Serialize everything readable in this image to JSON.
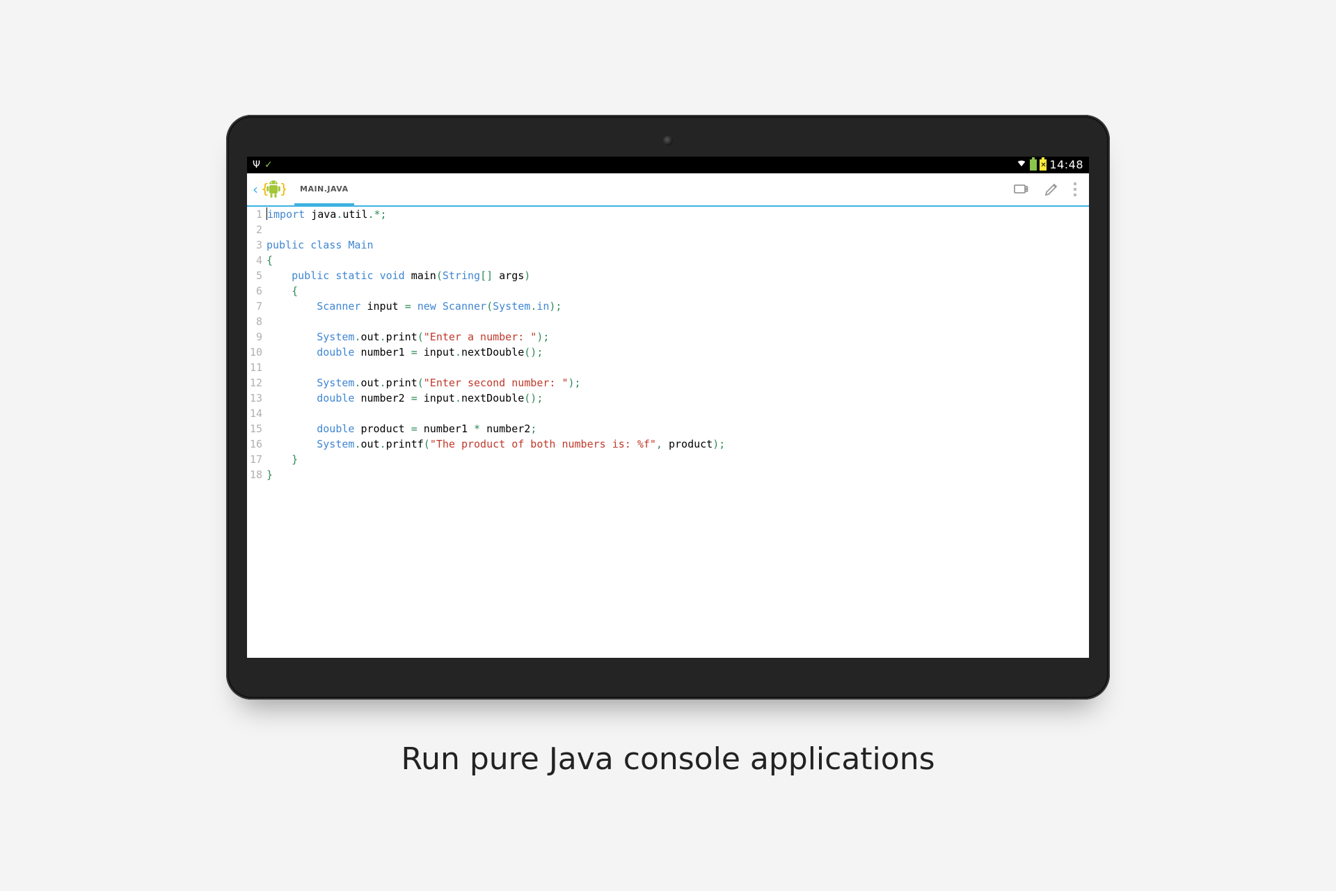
{
  "statusbar": {
    "time": "14:48",
    "icons": {
      "usb": "Ψ",
      "check": "✓"
    }
  },
  "appbar": {
    "tab_label": "MAIN.JAVA"
  },
  "caption": "Run pure Java console applications",
  "code": {
    "lines": [
      {
        "n": "1",
        "spans": [
          {
            "c": "cursor",
            "t": ""
          },
          {
            "c": "kw",
            "t": "import"
          },
          {
            "c": "id",
            "t": " java"
          },
          {
            "c": "pun",
            "t": "."
          },
          {
            "c": "id",
            "t": "util"
          },
          {
            "c": "pun",
            "t": ".*;"
          }
        ]
      },
      {
        "n": "2",
        "spans": []
      },
      {
        "n": "3",
        "spans": [
          {
            "c": "kw",
            "t": "public"
          },
          {
            "c": "id",
            "t": " "
          },
          {
            "c": "kw",
            "t": "class"
          },
          {
            "c": "id",
            "t": " "
          },
          {
            "c": "typ",
            "t": "Main"
          }
        ]
      },
      {
        "n": "4",
        "spans": [
          {
            "c": "pun",
            "t": "{"
          }
        ]
      },
      {
        "n": "5",
        "spans": [
          {
            "c": "id",
            "t": "    "
          },
          {
            "c": "kw",
            "t": "public"
          },
          {
            "c": "id",
            "t": " "
          },
          {
            "c": "kw",
            "t": "static"
          },
          {
            "c": "id",
            "t": " "
          },
          {
            "c": "kw",
            "t": "void"
          },
          {
            "c": "id",
            "t": " main"
          },
          {
            "c": "pun",
            "t": "("
          },
          {
            "c": "typ",
            "t": "String"
          },
          {
            "c": "pun",
            "t": "[]"
          },
          {
            "c": "id",
            "t": " args"
          },
          {
            "c": "pun",
            "t": ")"
          }
        ]
      },
      {
        "n": "6",
        "spans": [
          {
            "c": "id",
            "t": "    "
          },
          {
            "c": "pun",
            "t": "{"
          }
        ]
      },
      {
        "n": "7",
        "spans": [
          {
            "c": "id",
            "t": "        "
          },
          {
            "c": "typ",
            "t": "Scanner"
          },
          {
            "c": "id",
            "t": " input "
          },
          {
            "c": "pun",
            "t": "="
          },
          {
            "c": "id",
            "t": " "
          },
          {
            "c": "kw",
            "t": "new"
          },
          {
            "c": "id",
            "t": " "
          },
          {
            "c": "typ",
            "t": "Scanner"
          },
          {
            "c": "pun",
            "t": "("
          },
          {
            "c": "typ",
            "t": "System"
          },
          {
            "c": "pun",
            "t": "."
          },
          {
            "c": "typ",
            "t": "in"
          },
          {
            "c": "pun",
            "t": ");"
          }
        ]
      },
      {
        "n": "8",
        "spans": []
      },
      {
        "n": "9",
        "spans": [
          {
            "c": "id",
            "t": "        "
          },
          {
            "c": "typ",
            "t": "System"
          },
          {
            "c": "pun",
            "t": "."
          },
          {
            "c": "id",
            "t": "out"
          },
          {
            "c": "pun",
            "t": "."
          },
          {
            "c": "id",
            "t": "print"
          },
          {
            "c": "pun",
            "t": "("
          },
          {
            "c": "str",
            "t": "\"Enter a number: \""
          },
          {
            "c": "pun",
            "t": ");"
          }
        ]
      },
      {
        "n": "10",
        "spans": [
          {
            "c": "id",
            "t": "        "
          },
          {
            "c": "kw",
            "t": "double"
          },
          {
            "c": "id",
            "t": " number1 "
          },
          {
            "c": "pun",
            "t": "="
          },
          {
            "c": "id",
            "t": " input"
          },
          {
            "c": "pun",
            "t": "."
          },
          {
            "c": "id",
            "t": "nextDouble"
          },
          {
            "c": "pun",
            "t": "();"
          }
        ]
      },
      {
        "n": "11",
        "spans": []
      },
      {
        "n": "12",
        "spans": [
          {
            "c": "id",
            "t": "        "
          },
          {
            "c": "typ",
            "t": "System"
          },
          {
            "c": "pun",
            "t": "."
          },
          {
            "c": "id",
            "t": "out"
          },
          {
            "c": "pun",
            "t": "."
          },
          {
            "c": "id",
            "t": "print"
          },
          {
            "c": "pun",
            "t": "("
          },
          {
            "c": "str",
            "t": "\"Enter second number: \""
          },
          {
            "c": "pun",
            "t": ");"
          }
        ]
      },
      {
        "n": "13",
        "spans": [
          {
            "c": "id",
            "t": "        "
          },
          {
            "c": "kw",
            "t": "double"
          },
          {
            "c": "id",
            "t": " number2 "
          },
          {
            "c": "pun",
            "t": "="
          },
          {
            "c": "id",
            "t": " input"
          },
          {
            "c": "pun",
            "t": "."
          },
          {
            "c": "id",
            "t": "nextDouble"
          },
          {
            "c": "pun",
            "t": "();"
          }
        ]
      },
      {
        "n": "14",
        "spans": []
      },
      {
        "n": "15",
        "spans": [
          {
            "c": "id",
            "t": "        "
          },
          {
            "c": "kw",
            "t": "double"
          },
          {
            "c": "id",
            "t": " product "
          },
          {
            "c": "pun",
            "t": "="
          },
          {
            "c": "id",
            "t": " number1 "
          },
          {
            "c": "pun",
            "t": "*"
          },
          {
            "c": "id",
            "t": " number2"
          },
          {
            "c": "pun",
            "t": ";"
          }
        ]
      },
      {
        "n": "16",
        "spans": [
          {
            "c": "id",
            "t": "        "
          },
          {
            "c": "typ",
            "t": "System"
          },
          {
            "c": "pun",
            "t": "."
          },
          {
            "c": "id",
            "t": "out"
          },
          {
            "c": "pun",
            "t": "."
          },
          {
            "c": "id",
            "t": "printf"
          },
          {
            "c": "pun",
            "t": "("
          },
          {
            "c": "str",
            "t": "\"The product of both numbers is: %f\""
          },
          {
            "c": "pun",
            "t": ","
          },
          {
            "c": "id",
            "t": " product"
          },
          {
            "c": "pun",
            "t": ");"
          }
        ]
      },
      {
        "n": "17",
        "spans": [
          {
            "c": "id",
            "t": "    "
          },
          {
            "c": "pun",
            "t": "}"
          }
        ]
      },
      {
        "n": "18",
        "spans": [
          {
            "c": "pun",
            "t": "}"
          }
        ]
      }
    ]
  }
}
